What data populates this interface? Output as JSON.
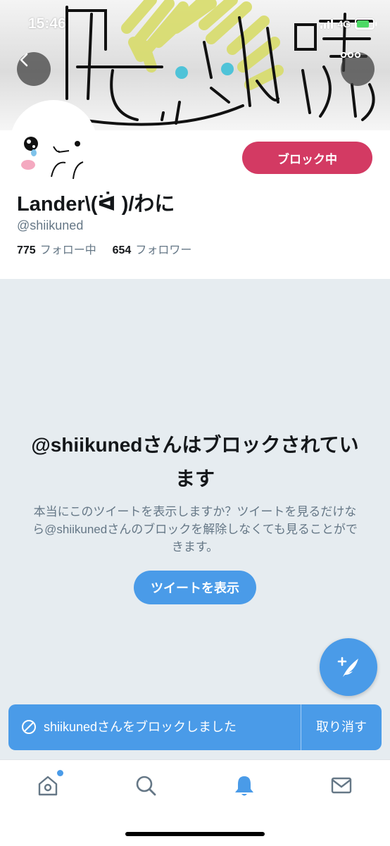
{
  "status_bar": {
    "time": "15:46",
    "network": "4G",
    "battery_level": 0.7
  },
  "header": {
    "back_icon": "chevron-left-icon",
    "more_icon": "more-horizontal-icon",
    "banner_text": "晴ない"
  },
  "profile": {
    "name": "Lander\\(ᐛ )/わに",
    "handle": "@shiikuned",
    "following_count": "775",
    "following_label": "フォロー中",
    "followers_count": "654",
    "followers_label": "フォロワー",
    "block_button_label": "ブロック中"
  },
  "blocked_notice": {
    "title": "@shiikunedさんはブロックされています",
    "description": "本当にこのツイートを表示しますか？ツイートを見るだけなら@shiikunedさんのブロックを解除しなくても見ることができます。",
    "show_tweets_label": "ツイートを表示"
  },
  "compose": {
    "icon": "compose-feather-icon"
  },
  "toast": {
    "icon": "block-icon",
    "message": "shiikunedさんをブロックしました",
    "undo_label": "取り消す"
  },
  "bottom_nav": {
    "items": [
      {
        "name": "home",
        "icon": "home-icon",
        "has_notification_dot": true
      },
      {
        "name": "search",
        "icon": "search-icon"
      },
      {
        "name": "notifications",
        "icon": "bell-icon",
        "active": true
      },
      {
        "name": "messages",
        "icon": "mail-icon"
      }
    ]
  },
  "colors": {
    "accent": "#4a9be8",
    "blocked_button": "#d33a63",
    "background_gray": "#e6ecf0",
    "secondary_text": "#657786"
  }
}
